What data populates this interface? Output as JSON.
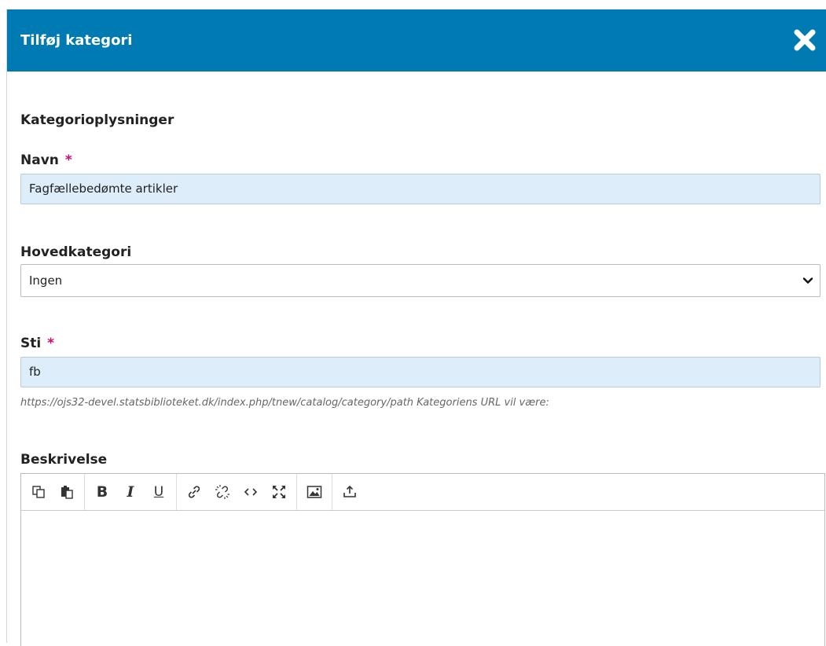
{
  "dialog": {
    "title": "Tilføj kategori",
    "close_icon": "close-icon"
  },
  "form": {
    "section_title": "Kategorioplysninger",
    "name": {
      "label": "Navn",
      "required_marker": "*",
      "value": "Fagfællebedømte artikler"
    },
    "parent": {
      "label": "Hovedkategori",
      "selected": "Ingen"
    },
    "path": {
      "label": "Sti",
      "required_marker": "*",
      "value": "fb",
      "hint": "https://ojs32-devel.statsbiblioteket.dk/index.php/tnew/catalog/category/path Kategoriens URL vil være:"
    },
    "description": {
      "label": "Beskrivelse",
      "toolbar": {
        "bold": "B",
        "italic": "I",
        "underline": "U"
      }
    }
  },
  "colors": {
    "header": "#007ab2",
    "required": "#d00a6c",
    "filled_input": "#ddeefa"
  }
}
